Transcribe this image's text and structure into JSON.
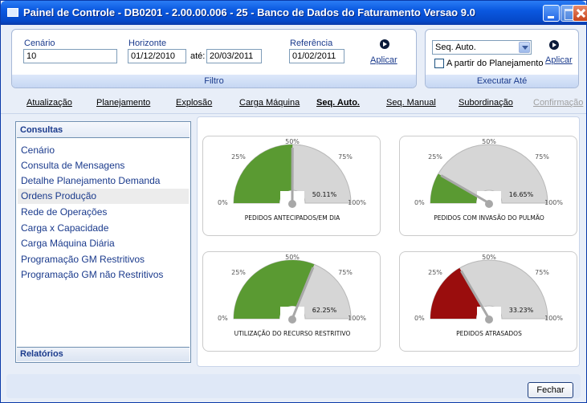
{
  "window": {
    "title": "Painel de Controle - DB0201 - 2.00.00.006 - 25 - Banco de Dados do Faturamento Versao 9.0"
  },
  "filtro": {
    "cenario_label": "Cenário",
    "cenario_value": "10",
    "horizonte_label": "Horizonte",
    "horizonte_start": "01/12/2010",
    "ate_label": "até:",
    "horizonte_end": "20/03/2011",
    "referencia_label": "Referência",
    "referencia_value": "01/02/2011",
    "apply_label": "Aplicar",
    "footer_label": "Filtro"
  },
  "executar": {
    "select_value": "Seq. Auto.",
    "checkbox_label": "A partir do Planejamento",
    "checkbox_checked": false,
    "apply_label": "Aplicar",
    "footer_label": "Executar Até"
  },
  "nav": {
    "items": [
      {
        "label": "Atualização"
      },
      {
        "label": "Planejamento"
      },
      {
        "label": "Explosão"
      },
      {
        "label": "Carga Máquina"
      },
      {
        "label": "Seq. Auto."
      },
      {
        "label": "Seq. Manual"
      },
      {
        "label": "Subordinação"
      },
      {
        "label": "Confirmação"
      }
    ],
    "active": "Seq. Auto.",
    "disabled": "Confirmação"
  },
  "consultas": {
    "header": "Consultas",
    "items": [
      {
        "label": "Cenário"
      },
      {
        "label": "Consulta de Mensagens"
      },
      {
        "label": "Detalhe Planejamento Demanda"
      },
      {
        "label": "Ordens Produção"
      },
      {
        "label": "Rede de Operações"
      },
      {
        "label": "Carga x Capacidade"
      },
      {
        "label": "Carga Máquina Diária"
      },
      {
        "label": "Programação GM Restritivos"
      },
      {
        "label": "Programação GM não Restritivos"
      }
    ],
    "selected": "Ordens Produção",
    "footer": "Relatórios"
  },
  "gauges": {
    "tick_labels": [
      "0%",
      "25%",
      "50%",
      "75%",
      "100%"
    ],
    "items": [
      {
        "label": "PEDIDOS ANTECIPADOS/EM DIA",
        "value_text": "50.11%",
        "value": 50.11,
        "color": "#5a9a32"
      },
      {
        "label": "PEDIDOS COM INVASÃO DO PULMÃO",
        "value_text": "16.65%",
        "value": 16.65,
        "color": "#5a9a32"
      },
      {
        "label": "UTILIZAÇÃO DO RECURSO RESTRITIVO",
        "value_text": "62.25%",
        "value": 62.25,
        "color": "#5a9a32"
      },
      {
        "label": "PEDIDOS ATRASADOS",
        "value_text": "33.23%",
        "value": 33.23,
        "color": "#9a0d0d"
      }
    ]
  },
  "footer": {
    "close_label": "Fechar"
  }
}
